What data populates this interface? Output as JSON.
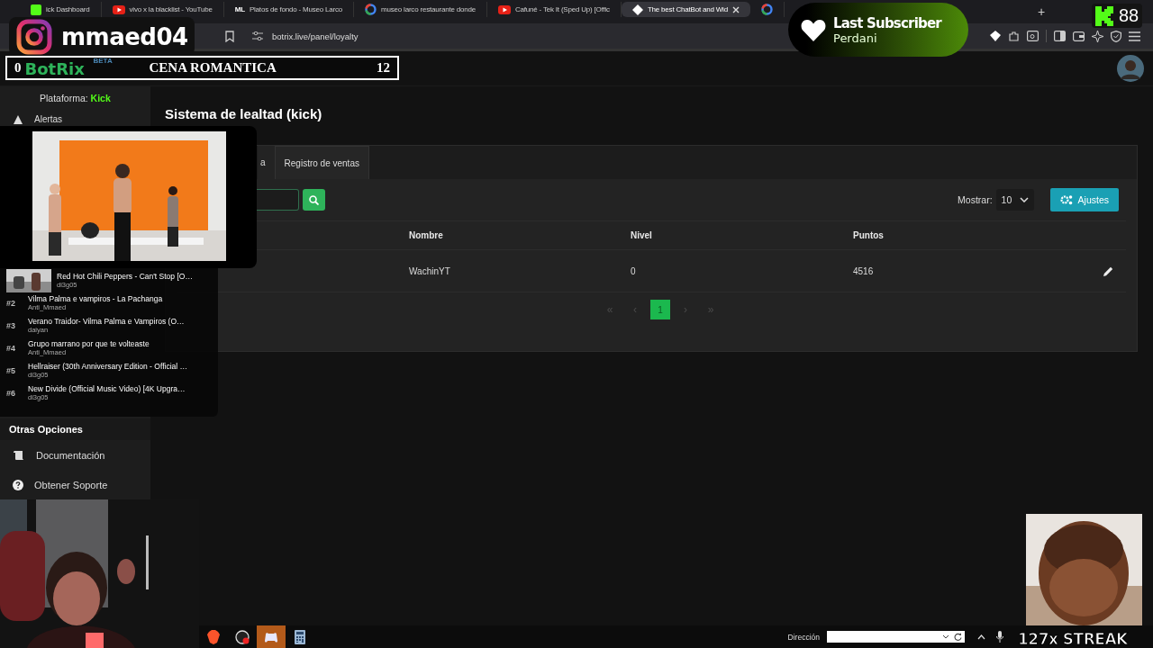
{
  "browser": {
    "tabs": [
      {
        "title": "ick Dashboard",
        "kind": "kick",
        "selected": false
      },
      {
        "title": "vivo x la blacklist - YouTube",
        "kind": "youtube",
        "selected": false
      },
      {
        "title": "Platos de fondo - Museo Larco",
        "kind": "text",
        "icon_text": "ML",
        "selected": false
      },
      {
        "title": "museo larco restaurante donde",
        "kind": "google",
        "selected": false
      },
      {
        "title": "Cafuné - Tek It (Sped Up) [Offic",
        "kind": "youtube",
        "selected": false
      },
      {
        "title": "The best ChatBot and Wid",
        "kind": "botrix",
        "selected": true
      },
      {
        "kind": "google",
        "selected": false
      }
    ],
    "new_tab": "+",
    "url": "botrix.live/panel/loyalty"
  },
  "overlays": {
    "instagram": {
      "handle": "mmaed04"
    },
    "counter": {
      "count": "0",
      "brand": "BotRix",
      "badge": "BETA",
      "goal": "CENA ROMANTICA",
      "target": "12"
    },
    "last_subscriber": {
      "title": "Last Subscriber",
      "name": "Perdani"
    },
    "kick_count": "88",
    "queue": [
      {
        "kind": "thumb",
        "title": "Red Hot Chili Peppers - Can't Stop [O…",
        "user": "di3g05"
      },
      {
        "kind": "rank",
        "rank": "#2",
        "title": "Vilma Palma e vampiros - La Pachanga",
        "user": "Anti_Mmaed"
      },
      {
        "kind": "rank",
        "rank": "#3",
        "title": "Verano Traidor- Vilma Palma e Vampiros (O…",
        "user": "daiyan"
      },
      {
        "kind": "rank",
        "rank": "#4",
        "title": "Grupo marrano por que te volteaste",
        "user": "Anti_Mmaed"
      },
      {
        "kind": "rank",
        "rank": "#5",
        "title": "Hellraiser (30th Anniversary Edition - Official …",
        "user": "di3g05"
      },
      {
        "kind": "rank",
        "rank": "#6",
        "title": "New Divide (Official Music Video) [4K Upgra…",
        "user": "di3g05"
      }
    ],
    "streak": "127x STREAK"
  },
  "sidebar": {
    "platform_label": "Plataforma:",
    "platform": "Kick",
    "items": [
      {
        "label": "Alertas",
        "kind": "bell"
      }
    ],
    "section": "Otras Opciones",
    "options": [
      {
        "label": "Documentación",
        "kind": "scroll"
      },
      {
        "label": "Obtener Soporte",
        "kind": "question"
      }
    ]
  },
  "page": {
    "title": "Sistema de lealtad (kick)",
    "tabs": [
      {
        "label": "a",
        "selected": true
      },
      {
        "label": "Registro de ventas",
        "selected": false
      }
    ],
    "show_label": "Mostrar:",
    "page_size": "10",
    "settings_button": "Ajustes",
    "table": {
      "columns": [
        "Nombre",
        "Nivel",
        "Puntos"
      ],
      "rows": [
        [
          "WachinYT",
          "0",
          "4516"
        ]
      ]
    },
    "pagination": [
      {
        "label": "«",
        "kind": "nav",
        "disabled": true
      },
      {
        "label": "‹",
        "kind": "nav",
        "disabled": true
      },
      {
        "label": "1",
        "kind": "page",
        "selected": true
      },
      {
        "label": "›",
        "kind": "nav",
        "disabled": true
      },
      {
        "label": "»",
        "kind": "nav",
        "disabled": true
      }
    ]
  },
  "taskbar": {
    "address_label": "Dirección"
  }
}
